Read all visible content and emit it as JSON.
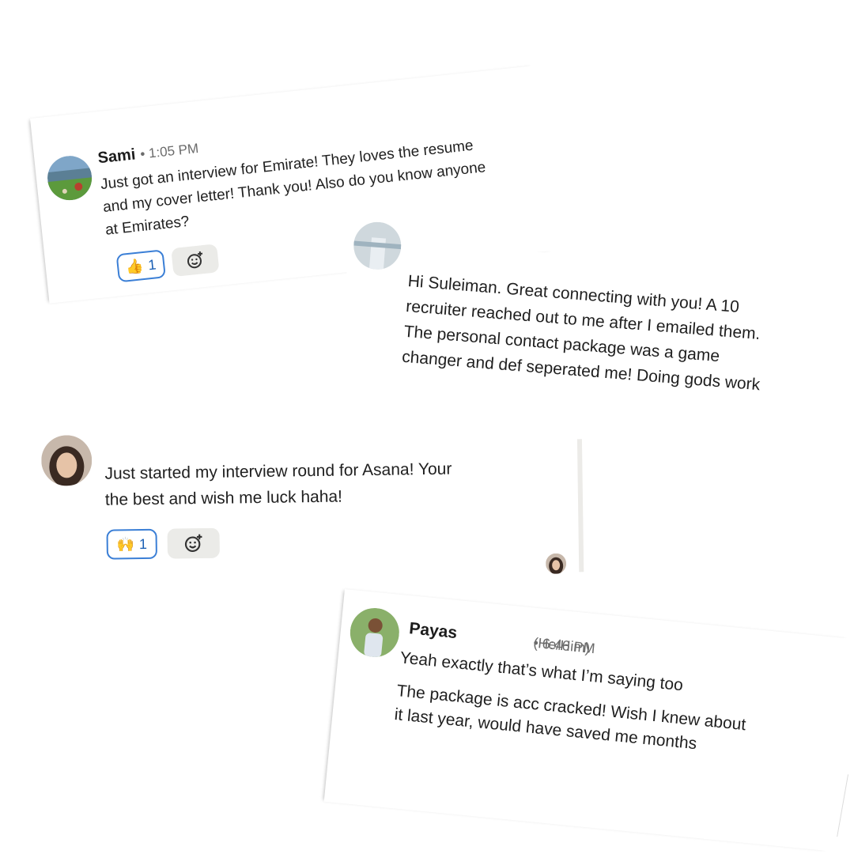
{
  "messages": {
    "sami": {
      "name": "Sami",
      "time": "• 1:05 PM",
      "lines": [
        "Just got an interview for Emirate! They loves the resume",
        "and my cover letter! Thank you! Also do you know anyone",
        "at Emirates?"
      ],
      "reaction": {
        "emoji": "👍",
        "count": "1"
      }
    },
    "suleiman": {
      "lines": [
        "Hi Suleiman. Great connecting with you! A 10",
        "recruiter reached out to me after I emailed them.",
        "The personal contact package was a game",
        "changer and def seperated me! Doing gods work"
      ]
    },
    "asana": {
      "lines": [
        "Just started my interview round for Asana! Your",
        "the best and wish me luck haha!"
      ],
      "reaction": {
        "emoji": "🙌",
        "count": "1"
      }
    },
    "payas": {
      "name": "Payas",
      "pronouns": "(He/Him)",
      "time": "• 6:46 PM",
      "lines": [
        "Yeah exactly that’s what I’m saying too",
        "The package is acc cracked! Wish I knew about",
        "it last year, would have saved me months"
      ]
    }
  },
  "icons": {
    "add_reaction": "add-reaction-icon"
  },
  "colors": {
    "reaction_border": "#3b7fd6",
    "add_reaction_bg": "#ebebe8",
    "meta_text": "#6b6b6b"
  }
}
